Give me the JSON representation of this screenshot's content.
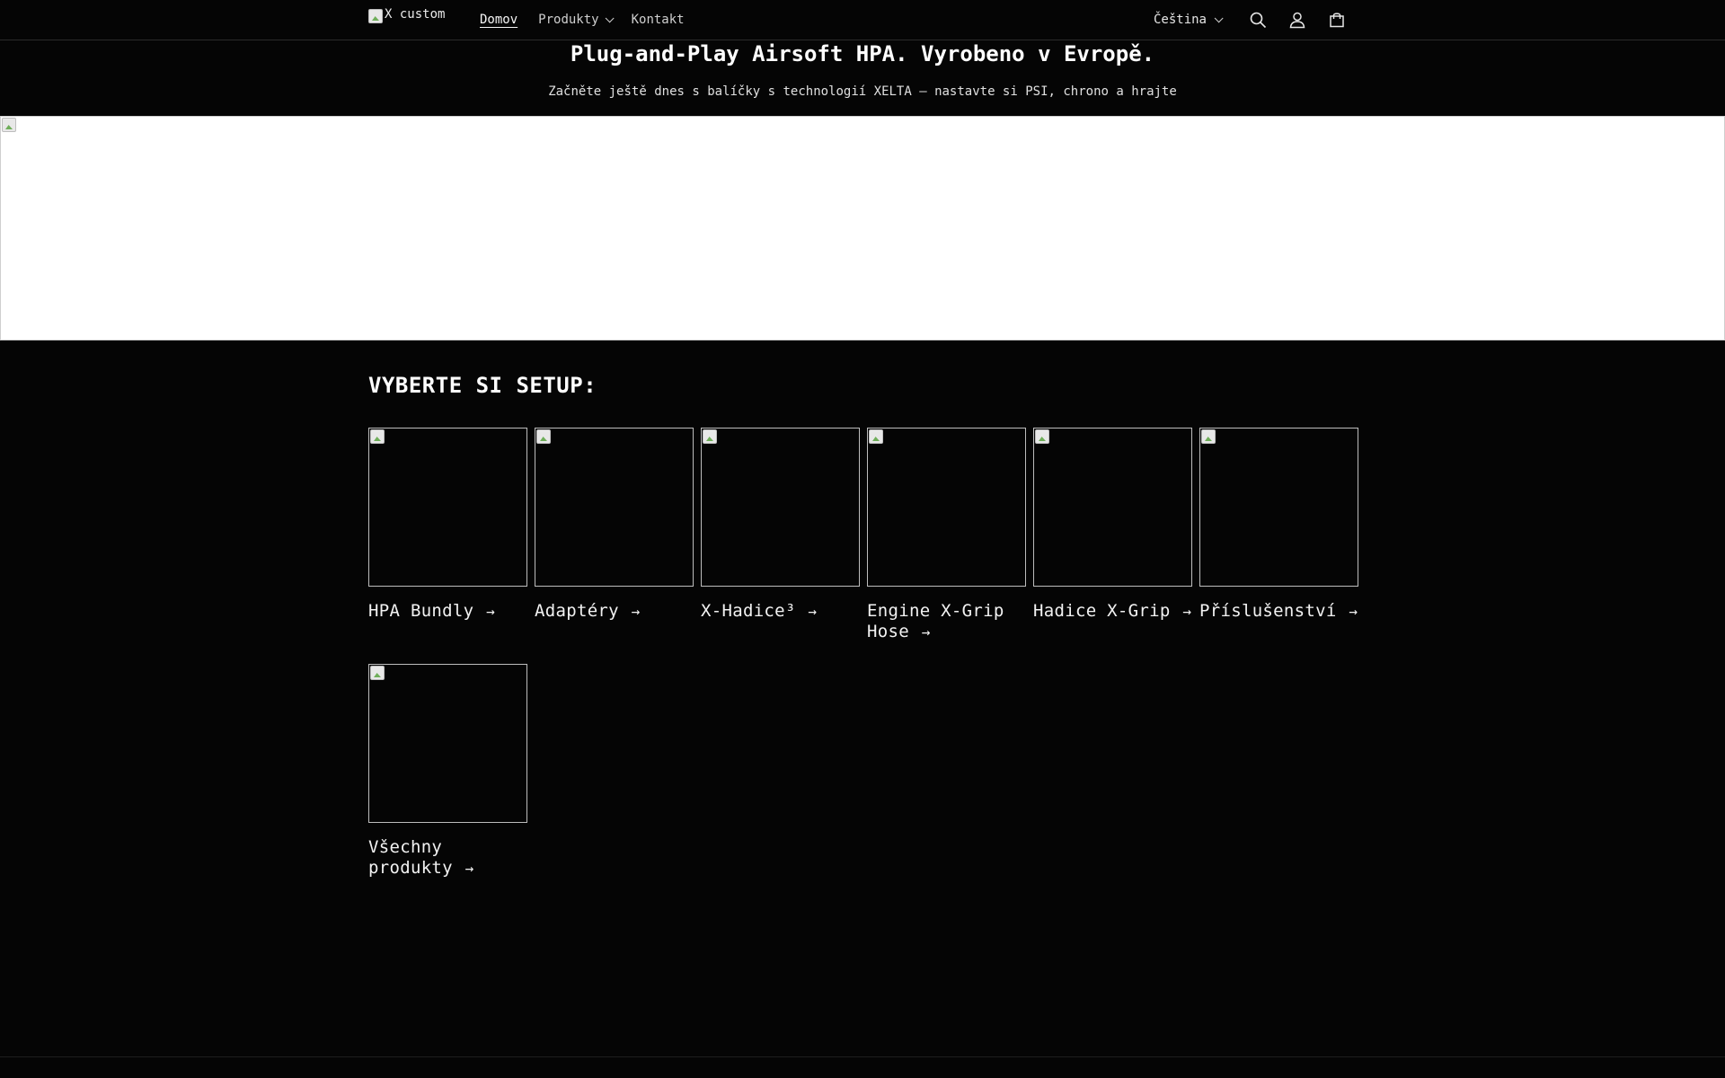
{
  "header": {
    "logo_alt": "X custom",
    "nav": [
      {
        "label": "Domov",
        "active": true,
        "dropdown": false
      },
      {
        "label": "Produkty",
        "active": false,
        "dropdown": true
      },
      {
        "label": "Kontakt",
        "active": false,
        "dropdown": false
      }
    ],
    "language": "Čeština",
    "icons": [
      "search-icon",
      "account-icon",
      "cart-icon"
    ]
  },
  "hero": {
    "title": "Plug-and-Play Airsoft HPA. Vyrobeno v Evropě.",
    "subtitle": "Začněte ještě dnes s balíčky s technologií XELTA – nastavte si PSI, chrono a hrajte"
  },
  "collections": {
    "title": "VYBERTE SI SETUP:",
    "items": [
      {
        "label": "HPA Bundly"
      },
      {
        "label": "Adaptéry"
      },
      {
        "label": "X-Hadice³"
      },
      {
        "label": "Engine X-Grip Hose"
      },
      {
        "label": "Hadice X-Grip"
      },
      {
        "label": "Příslušenství"
      },
      {
        "label": "Všechny produkty"
      }
    ],
    "arrow": "→"
  },
  "colors": {
    "background": "#050505",
    "text": "#f2f2f2",
    "banner": "#ffffff"
  }
}
